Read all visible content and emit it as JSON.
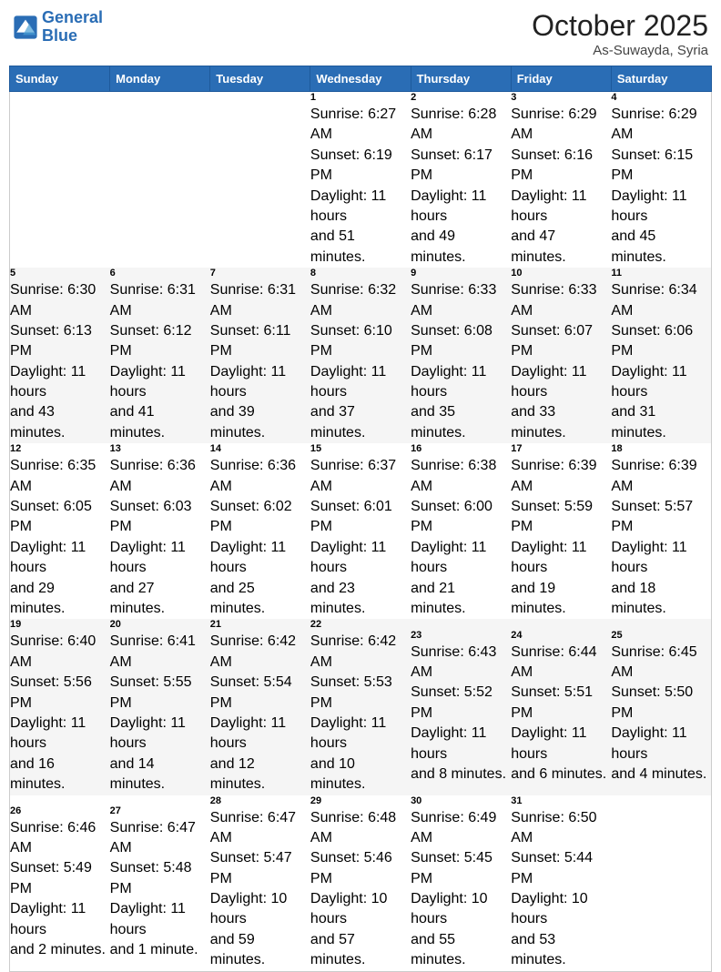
{
  "logo": {
    "line1": "General",
    "line2": "Blue"
  },
  "header": {
    "month": "October 2025",
    "location": "As-Suwayda, Syria"
  },
  "days_of_week": [
    "Sunday",
    "Monday",
    "Tuesday",
    "Wednesday",
    "Thursday",
    "Friday",
    "Saturday"
  ],
  "weeks": [
    [
      {
        "day": "",
        "info": ""
      },
      {
        "day": "",
        "info": ""
      },
      {
        "day": "",
        "info": ""
      },
      {
        "day": "1",
        "info": "Sunrise: 6:27 AM\nSunset: 6:19 PM\nDaylight: 11 hours\nand 51 minutes."
      },
      {
        "day": "2",
        "info": "Sunrise: 6:28 AM\nSunset: 6:17 PM\nDaylight: 11 hours\nand 49 minutes."
      },
      {
        "day": "3",
        "info": "Sunrise: 6:29 AM\nSunset: 6:16 PM\nDaylight: 11 hours\nand 47 minutes."
      },
      {
        "day": "4",
        "info": "Sunrise: 6:29 AM\nSunset: 6:15 PM\nDaylight: 11 hours\nand 45 minutes."
      }
    ],
    [
      {
        "day": "5",
        "info": "Sunrise: 6:30 AM\nSunset: 6:13 PM\nDaylight: 11 hours\nand 43 minutes."
      },
      {
        "day": "6",
        "info": "Sunrise: 6:31 AM\nSunset: 6:12 PM\nDaylight: 11 hours\nand 41 minutes."
      },
      {
        "day": "7",
        "info": "Sunrise: 6:31 AM\nSunset: 6:11 PM\nDaylight: 11 hours\nand 39 minutes."
      },
      {
        "day": "8",
        "info": "Sunrise: 6:32 AM\nSunset: 6:10 PM\nDaylight: 11 hours\nand 37 minutes."
      },
      {
        "day": "9",
        "info": "Sunrise: 6:33 AM\nSunset: 6:08 PM\nDaylight: 11 hours\nand 35 minutes."
      },
      {
        "day": "10",
        "info": "Sunrise: 6:33 AM\nSunset: 6:07 PM\nDaylight: 11 hours\nand 33 minutes."
      },
      {
        "day": "11",
        "info": "Sunrise: 6:34 AM\nSunset: 6:06 PM\nDaylight: 11 hours\nand 31 minutes."
      }
    ],
    [
      {
        "day": "12",
        "info": "Sunrise: 6:35 AM\nSunset: 6:05 PM\nDaylight: 11 hours\nand 29 minutes."
      },
      {
        "day": "13",
        "info": "Sunrise: 6:36 AM\nSunset: 6:03 PM\nDaylight: 11 hours\nand 27 minutes."
      },
      {
        "day": "14",
        "info": "Sunrise: 6:36 AM\nSunset: 6:02 PM\nDaylight: 11 hours\nand 25 minutes."
      },
      {
        "day": "15",
        "info": "Sunrise: 6:37 AM\nSunset: 6:01 PM\nDaylight: 11 hours\nand 23 minutes."
      },
      {
        "day": "16",
        "info": "Sunrise: 6:38 AM\nSunset: 6:00 PM\nDaylight: 11 hours\nand 21 minutes."
      },
      {
        "day": "17",
        "info": "Sunrise: 6:39 AM\nSunset: 5:59 PM\nDaylight: 11 hours\nand 19 minutes."
      },
      {
        "day": "18",
        "info": "Sunrise: 6:39 AM\nSunset: 5:57 PM\nDaylight: 11 hours\nand 18 minutes."
      }
    ],
    [
      {
        "day": "19",
        "info": "Sunrise: 6:40 AM\nSunset: 5:56 PM\nDaylight: 11 hours\nand 16 minutes."
      },
      {
        "day": "20",
        "info": "Sunrise: 6:41 AM\nSunset: 5:55 PM\nDaylight: 11 hours\nand 14 minutes."
      },
      {
        "day": "21",
        "info": "Sunrise: 6:42 AM\nSunset: 5:54 PM\nDaylight: 11 hours\nand 12 minutes."
      },
      {
        "day": "22",
        "info": "Sunrise: 6:42 AM\nSunset: 5:53 PM\nDaylight: 11 hours\nand 10 minutes."
      },
      {
        "day": "23",
        "info": "Sunrise: 6:43 AM\nSunset: 5:52 PM\nDaylight: 11 hours\nand 8 minutes."
      },
      {
        "day": "24",
        "info": "Sunrise: 6:44 AM\nSunset: 5:51 PM\nDaylight: 11 hours\nand 6 minutes."
      },
      {
        "day": "25",
        "info": "Sunrise: 6:45 AM\nSunset: 5:50 PM\nDaylight: 11 hours\nand 4 minutes."
      }
    ],
    [
      {
        "day": "26",
        "info": "Sunrise: 6:46 AM\nSunset: 5:49 PM\nDaylight: 11 hours\nand 2 minutes."
      },
      {
        "day": "27",
        "info": "Sunrise: 6:47 AM\nSunset: 5:48 PM\nDaylight: 11 hours\nand 1 minute."
      },
      {
        "day": "28",
        "info": "Sunrise: 6:47 AM\nSunset: 5:47 PM\nDaylight: 10 hours\nand 59 minutes."
      },
      {
        "day": "29",
        "info": "Sunrise: 6:48 AM\nSunset: 5:46 PM\nDaylight: 10 hours\nand 57 minutes."
      },
      {
        "day": "30",
        "info": "Sunrise: 6:49 AM\nSunset: 5:45 PM\nDaylight: 10 hours\nand 55 minutes."
      },
      {
        "day": "31",
        "info": "Sunrise: 6:50 AM\nSunset: 5:44 PM\nDaylight: 10 hours\nand 53 minutes."
      },
      {
        "day": "",
        "info": ""
      }
    ]
  ]
}
